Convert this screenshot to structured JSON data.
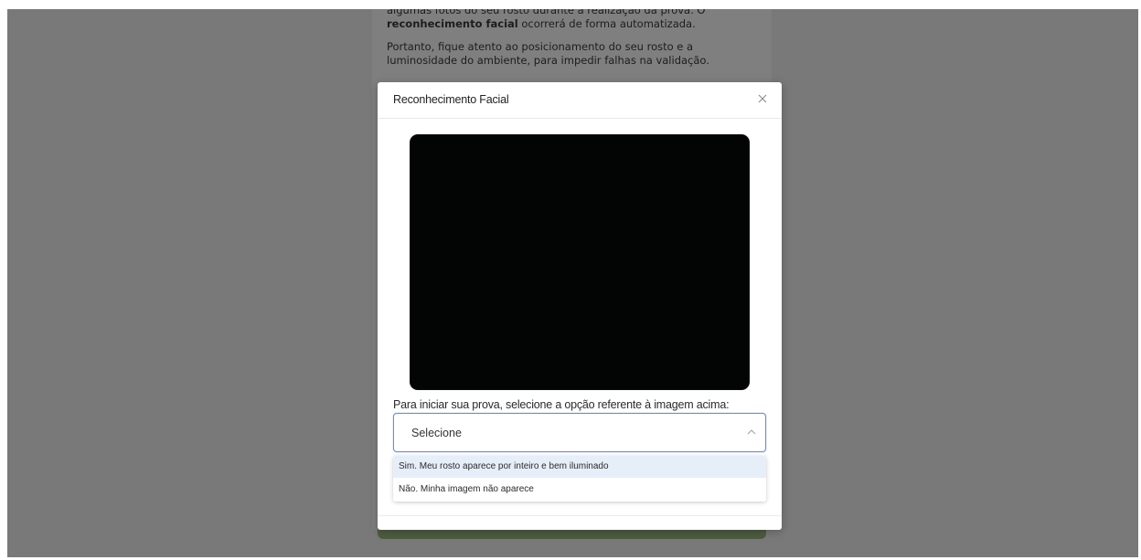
{
  "background": {
    "paragraph1_prefix": "algumas fotos do seu rosto durante a realização da prova. O",
    "paragraph1_bold": "reconhecimento facial",
    "paragraph1_suffix": " ocorrerá de forma automatizada.",
    "paragraph2_line1": "Portanto, fique atento ao posicionamento do seu rosto e a",
    "paragraph2_line2": "luminosidade do ambiente, para impedir falhas na validação."
  },
  "modal": {
    "title": "Reconhecimento Facial",
    "close_icon": "close-icon",
    "question": "Para iniciar sua prova, selecione a opção referente à imagem acima:",
    "select": {
      "value": "Selecione",
      "icon": "chevron-up-icon"
    },
    "options": [
      {
        "label": "Sim. Meu rosto aparece por inteiro e bem iluminado"
      },
      {
        "label": "Não. Minha imagem não aparece"
      }
    ]
  },
  "colors": {
    "overlay": "#808080",
    "select_border": "#6d8fc9",
    "highlighted_option": "#e6eefa",
    "video_background": "#030404",
    "accent_green": "#9cb884"
  }
}
